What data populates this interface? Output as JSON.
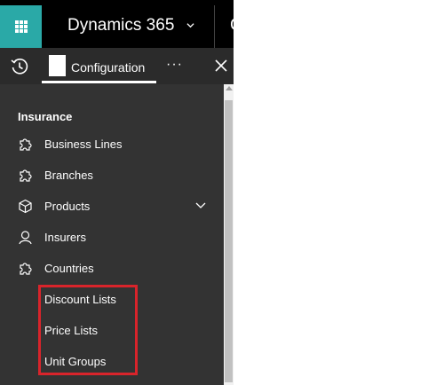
{
  "app": {
    "title": "Dynamics 365",
    "cut_text": "C"
  },
  "nav_header": {
    "active_tab_label": "Configuration",
    "more_label": "···"
  },
  "sidebar": {
    "section_title": "Insurance",
    "items": [
      {
        "label": "Business Lines",
        "icon": "puzzle-icon"
      },
      {
        "label": "Branches",
        "icon": "puzzle-icon"
      },
      {
        "label": "Products",
        "icon": "cube-icon",
        "expandable": true
      },
      {
        "label": "Insurers",
        "icon": "person-icon"
      },
      {
        "label": "Countries",
        "icon": "puzzle-icon"
      }
    ],
    "sub_items": [
      {
        "label": "Discount Lists"
      },
      {
        "label": "Price Lists"
      },
      {
        "label": "Unit Groups"
      }
    ]
  },
  "colors": {
    "accent": "#2aa9a7",
    "highlight": "#d9242b",
    "sidebar_bg": "#333333"
  }
}
